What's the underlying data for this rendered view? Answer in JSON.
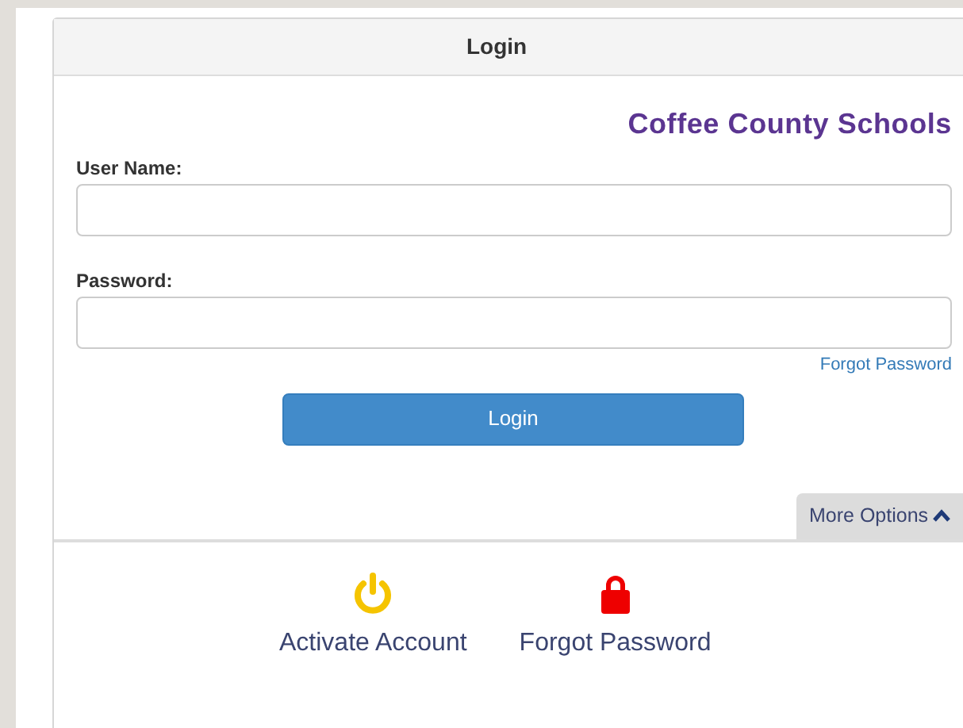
{
  "panel": {
    "title": "Login"
  },
  "brand": "Coffee County Schools",
  "fields": [
    {
      "label": "User Name:"
    },
    {
      "label": "Password:"
    }
  ],
  "forgot_link": "Forgot Password",
  "login_button": "Login",
  "more_options": {
    "label": "More Options",
    "expanded": true
  },
  "options": [
    {
      "label": "Activate Account",
      "kind": "power",
      "color": "#f5c400"
    },
    {
      "label": "Forgot Password",
      "kind": "lock",
      "color": "#ee0000"
    }
  ]
}
